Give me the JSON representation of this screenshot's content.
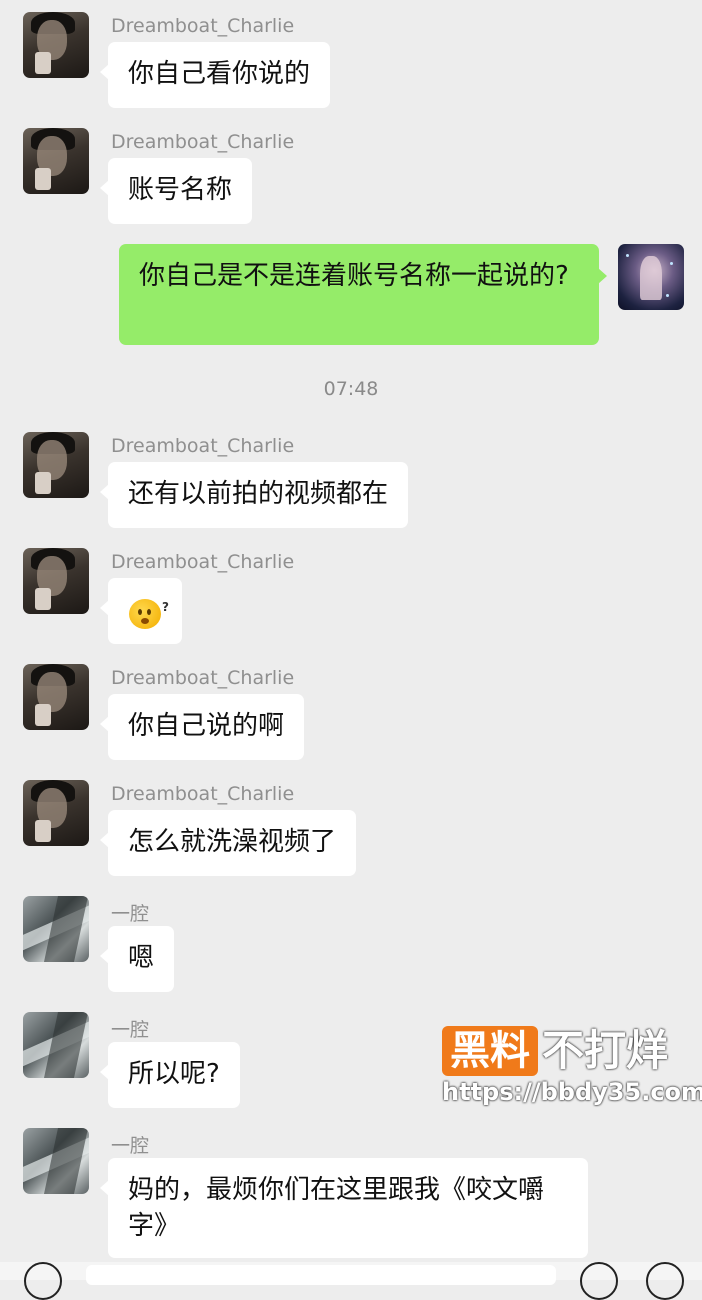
{
  "time_divider": "07:48",
  "messages": [
    {
      "sender": "Dreamboat_Charlie",
      "text": "你自己看你说的"
    },
    {
      "sender": "Dreamboat_Charlie",
      "text": "账号名称"
    },
    {
      "sender": "me",
      "text": "你自己是不是连着账号名称一起说的?"
    },
    {
      "sender": "Dreamboat_Charlie",
      "text": "还有以前拍的视频都在"
    },
    {
      "sender": "Dreamboat_Charlie",
      "emoji": "confused-emoji"
    },
    {
      "sender": "Dreamboat_Charlie",
      "text": "你自己说的啊"
    },
    {
      "sender": "Dreamboat_Charlie",
      "text": "怎么就洗澡视频了"
    },
    {
      "sender": "一腔",
      "text": "嗯"
    },
    {
      "sender": "一腔",
      "text": "所以呢?"
    },
    {
      "sender": "一腔",
      "text": "妈的，最烦你们在这里跟我《咬文嚼字》"
    }
  ],
  "watermark": {
    "box_text": "黑料",
    "text": "不打烊",
    "url": "https://bbdy35.com",
    "accent": "#f07a1a"
  },
  "colors": {
    "background": "#ededed",
    "incoming_bubble": "#ffffff",
    "outgoing_bubble": "#95ec69"
  }
}
